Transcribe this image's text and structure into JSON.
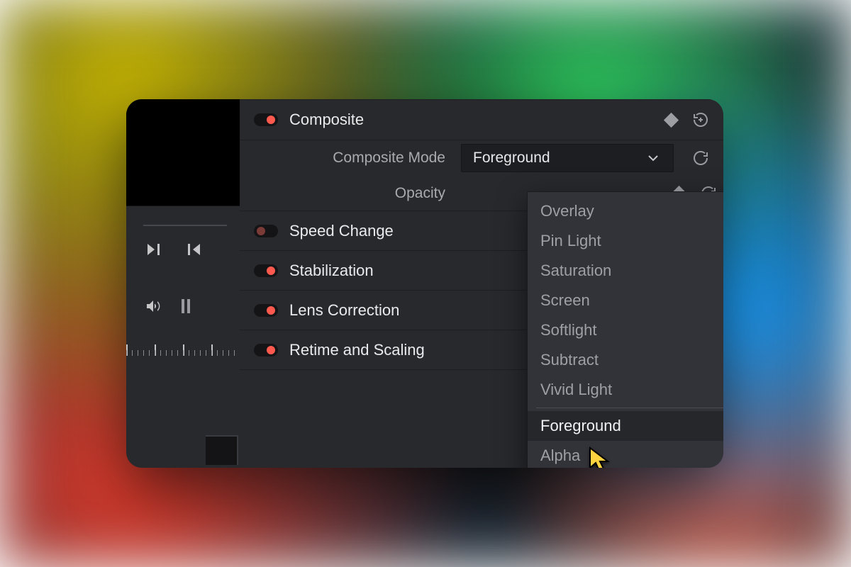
{
  "sections": {
    "composite": {
      "label": "Composite",
      "toggle_on": true,
      "props": {
        "mode_label": "Composite Mode",
        "mode_value": "Foreground",
        "opacity_label": "Opacity"
      }
    },
    "speed": {
      "label": "Speed Change",
      "toggle_on": false
    },
    "stab": {
      "label": "Stabilization",
      "toggle_on": true
    },
    "lens": {
      "label": "Lens Correction",
      "toggle_on": true
    },
    "retime": {
      "label": "Retime and Scaling",
      "toggle_on": true
    }
  },
  "dropdown": {
    "options": [
      "Overlay",
      "Pin Light",
      "Saturation",
      "Screen",
      "Softlight",
      "Subtract",
      "Vivid Light"
    ],
    "footer": [
      "Foreground",
      "Alpha"
    ],
    "highlighted": "Foreground"
  }
}
